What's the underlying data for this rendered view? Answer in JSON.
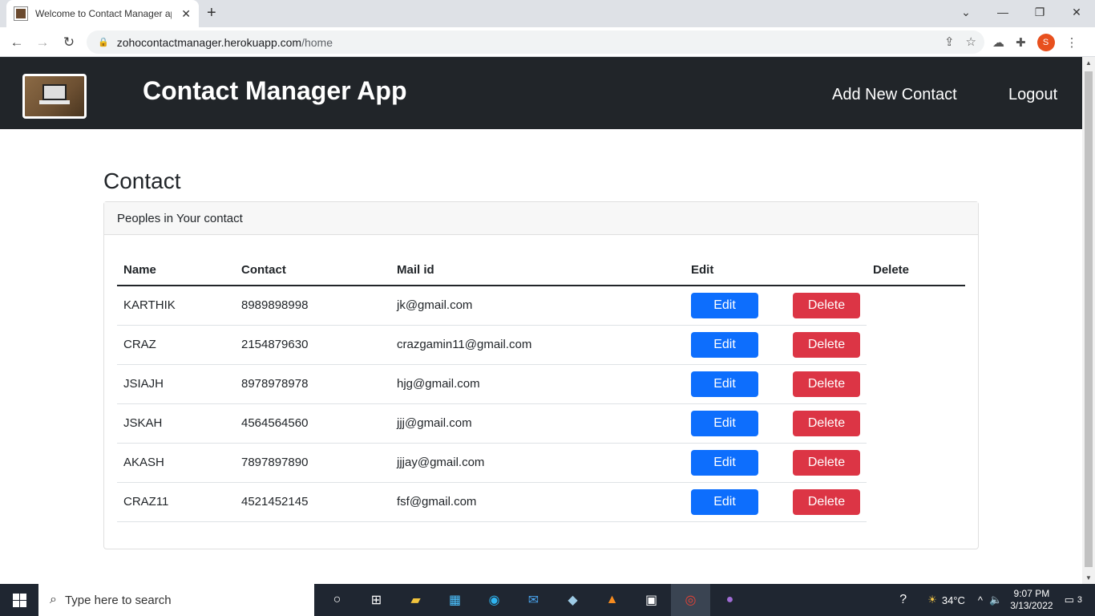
{
  "browser": {
    "tab_title": "Welcome to Contact Manager ap",
    "url_host": "zohocontactmanager.herokuapp.com",
    "url_path": "/home",
    "profile_initial": "S"
  },
  "navbar": {
    "title": "Contact Manager App",
    "add_link": "Add New Contact",
    "logout_link": "Logout"
  },
  "page": {
    "heading": "Contact",
    "card_header": "Peoples in Your contact"
  },
  "table": {
    "headers": {
      "name": "Name",
      "contact": "Contact",
      "mail": "Mail id",
      "edit": "Edit",
      "delete": "Delete"
    },
    "edit_label": "Edit",
    "delete_label": "Delete",
    "rows": [
      {
        "name": "KARTHIK",
        "contact": "8989898998",
        "mail": "jk@gmail.com"
      },
      {
        "name": "CRAZ",
        "contact": "2154879630",
        "mail": "crazgamin11@gmail.com"
      },
      {
        "name": "JSIAJH",
        "contact": "8978978978",
        "mail": "hjg@gmail.com"
      },
      {
        "name": "JSKAH",
        "contact": "4564564560",
        "mail": "jjj@gmail.com"
      },
      {
        "name": "AKASH",
        "contact": "7897897890",
        "mail": "jjjay@gmail.com"
      },
      {
        "name": "CRAZ11",
        "contact": "4521452145",
        "mail": "fsf@gmail.com"
      }
    ]
  },
  "taskbar": {
    "search_placeholder": "Type here to search",
    "weather": "34°C",
    "time": "9:07 PM",
    "date": "3/13/2022",
    "notifications": "3"
  },
  "colors": {
    "navbar": "#212529",
    "edit": "#0d6efd",
    "delete": "#dc3545"
  }
}
